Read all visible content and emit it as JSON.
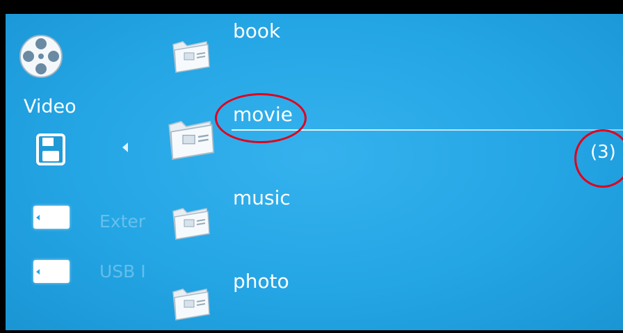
{
  "sidebar": {
    "category_label": "Video",
    "category_icon": "film-reel-icon",
    "storage_icon": "floppy-disk-icon",
    "sources": [
      {
        "label": "Exter",
        "icon": "sd-card-icon"
      },
      {
        "label": "USB I",
        "icon": "usb-card-icon"
      }
    ]
  },
  "folders": [
    {
      "label": "book",
      "icon": "folder-icon"
    },
    {
      "label": "movie",
      "icon": "folder-icon",
      "selected": true
    },
    {
      "label": "music",
      "icon": "folder-icon"
    },
    {
      "label": "photo",
      "icon": "folder-icon"
    }
  ],
  "selected_count": "(3)",
  "colors": {
    "background": "#24a5e4",
    "highlight_ring": "#e0001b",
    "text": "#ffffff"
  }
}
